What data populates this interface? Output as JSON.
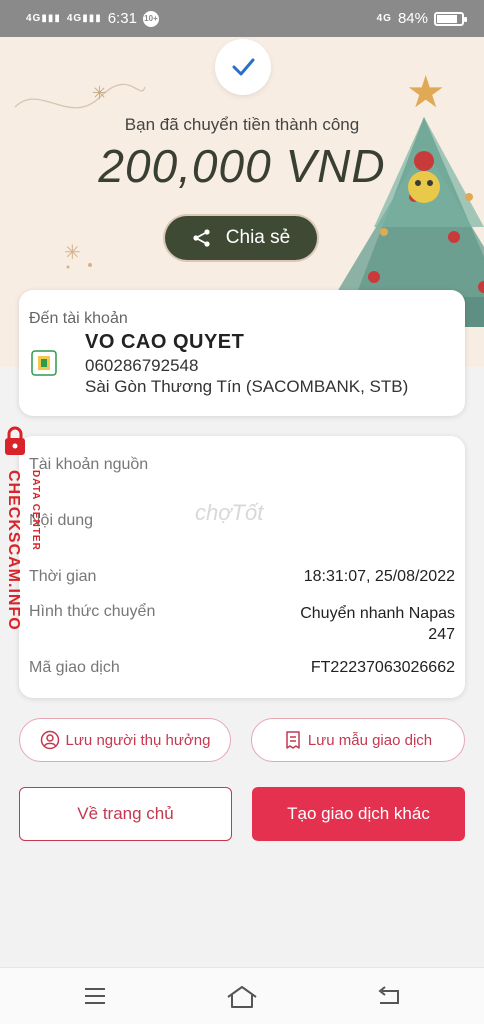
{
  "status_bar": {
    "network1": "4G",
    "network2": "4G",
    "time": "6:31",
    "notif": "10+",
    "network_right": "4G",
    "battery": "84%",
    "battery_level": 0.84
  },
  "hero": {
    "subtitle": "Bạn đã chuyển tiền thành công",
    "amount": "200,000 VND",
    "share_label": "Chia sẻ"
  },
  "destination": {
    "label": "Đến tài khoản",
    "name": "VO CAO QUYET",
    "account": "060286792548",
    "bank": "Sài Gòn Thương Tín (SACOMBANK, STB)"
  },
  "details": {
    "source_label": "Tài khoản nguồn",
    "content_label": "Nội dung",
    "time_label": "Thời gian",
    "time_value": "18:31:07, 25/08/2022",
    "method_label": "Hình thức chuyển",
    "method_value_line1": "Chuyển nhanh Napas",
    "method_value_line2": "247",
    "txid_label": "Mã giao dịch",
    "txid_value": "FT22237063026662"
  },
  "actions": {
    "save_beneficiary": "Lưu người thụ hưởng",
    "save_template": "Lưu mẫu giao dịch",
    "home": "Về trang chủ",
    "new_transaction": "Tạo giao dịch khác"
  },
  "watermark": {
    "main": "CHECKSCAM.INFO",
    "sub": "DATA CENTER",
    "cho": "chợTốt"
  },
  "colors": {
    "accent": "#e4314f",
    "hero_bg": "#f7ede3",
    "share_bg": "#3f4a35"
  }
}
